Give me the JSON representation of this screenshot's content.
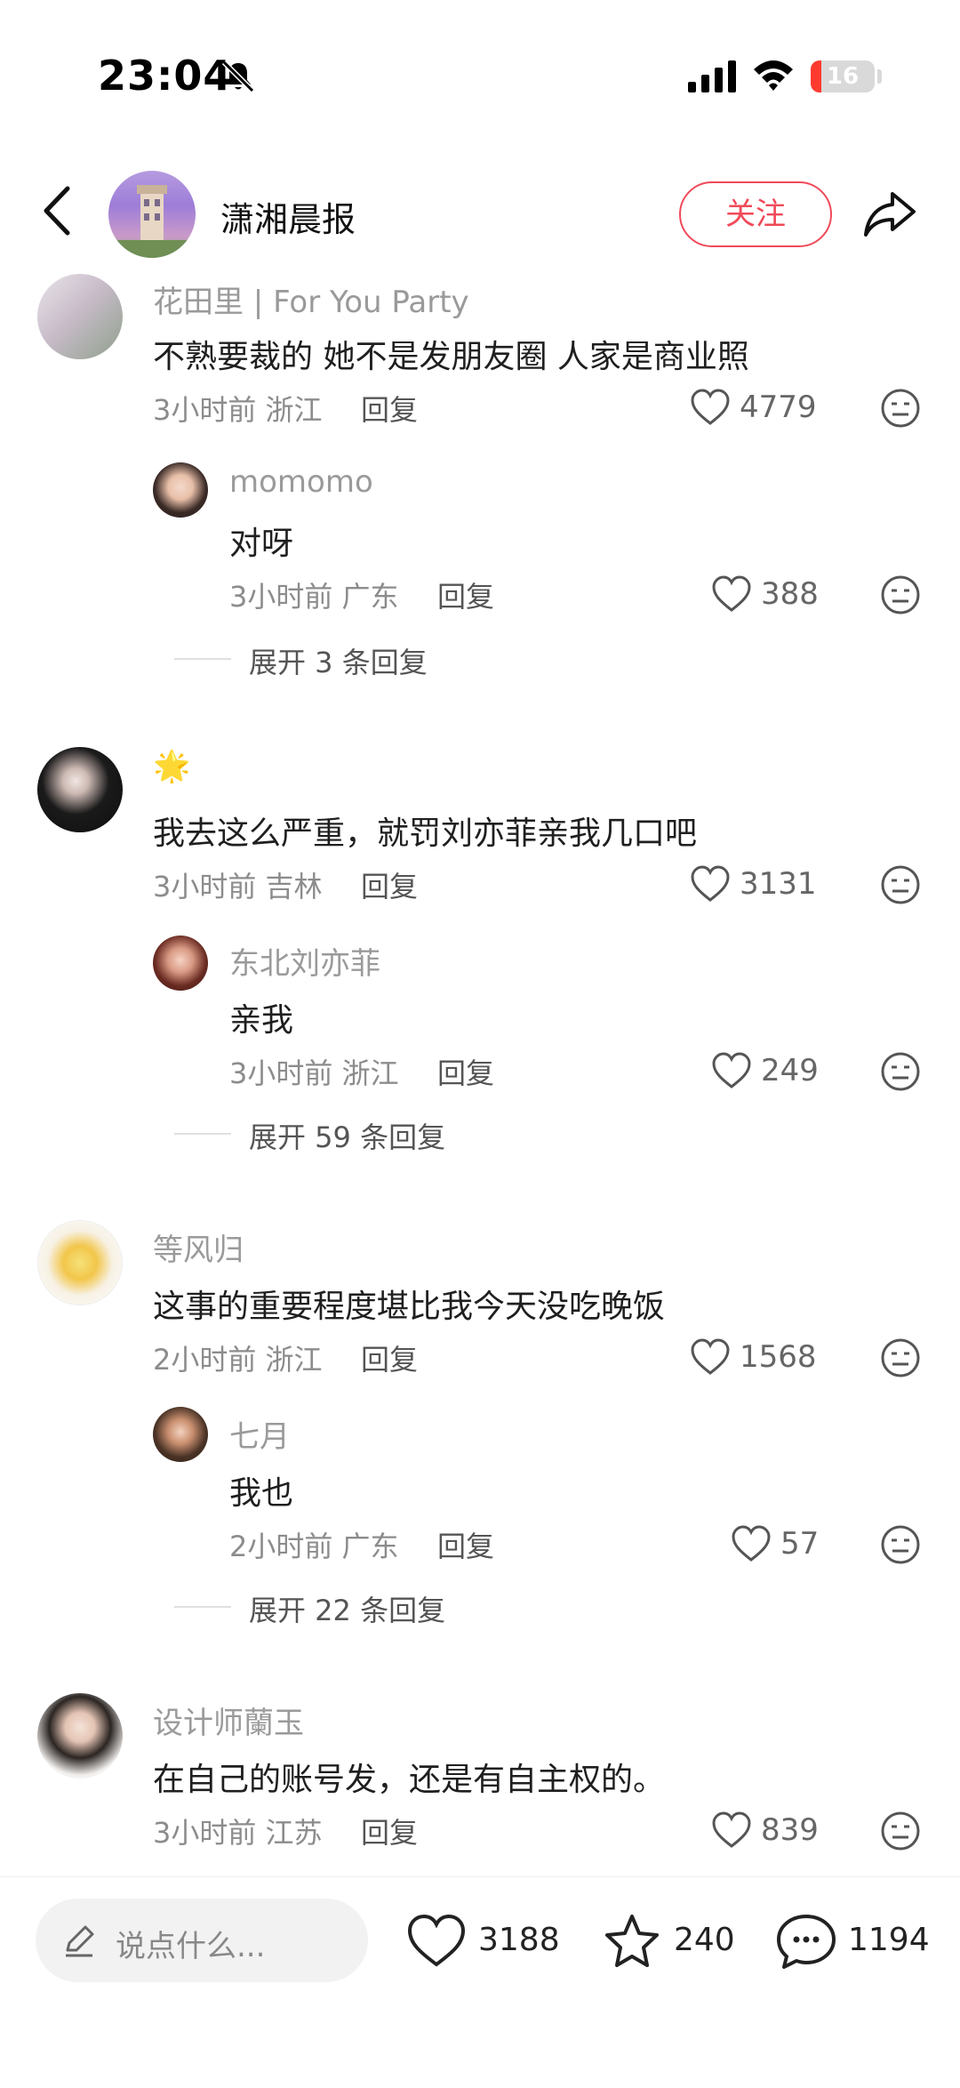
{
  "status_bar": {
    "time": "23:04",
    "battery_level": "16",
    "battery_fraction": 0.16
  },
  "nav": {
    "channel_name": "潇湘晨报",
    "follow_label": "关注"
  },
  "comments": [
    {
      "name": "花田里 | For You Party",
      "text": "不熟要裁的 她不是发朋友圈 人家是商业照",
      "meta": "3小时前 浙江",
      "reply_label": "回复",
      "likes": "4779",
      "reply": {
        "name": "momomo",
        "text": "对呀",
        "meta": "3小时前 广东",
        "reply_label": "回复",
        "likes": "388"
      },
      "expand": "展开 3 条回复"
    },
    {
      "name": "🌟",
      "text": "我去这么严重，就罚刘亦菲亲我几口吧",
      "meta": "3小时前 吉林",
      "reply_label": "回复",
      "likes": "3131",
      "reply": {
        "name": "东北刘亦菲",
        "text": "亲我",
        "meta": "3小时前 浙江",
        "reply_label": "回复",
        "likes": "249"
      },
      "expand": "展开 59 条回复"
    },
    {
      "name": "等风归",
      "text": "这事的重要程度堪比我今天没吃晚饭",
      "meta": "2小时前 浙江",
      "reply_label": "回复",
      "likes": "1568",
      "reply": {
        "name": "七月",
        "text": "我也",
        "meta": "2小时前 广东",
        "reply_label": "回复",
        "likes": "57"
      },
      "expand": "展开 22 条回复"
    },
    {
      "name": "设计师蘭玉",
      "text": "在自己的账号发，还是有自主权的。",
      "meta": "3小时前 江苏",
      "reply_label": "回复",
      "likes": "839"
    }
  ],
  "bottom_bar": {
    "input_placeholder": "说点什么...",
    "likes": "3188",
    "favorites": "240",
    "comments": "1194"
  },
  "colors": {
    "accent": "#f04a5a"
  }
}
